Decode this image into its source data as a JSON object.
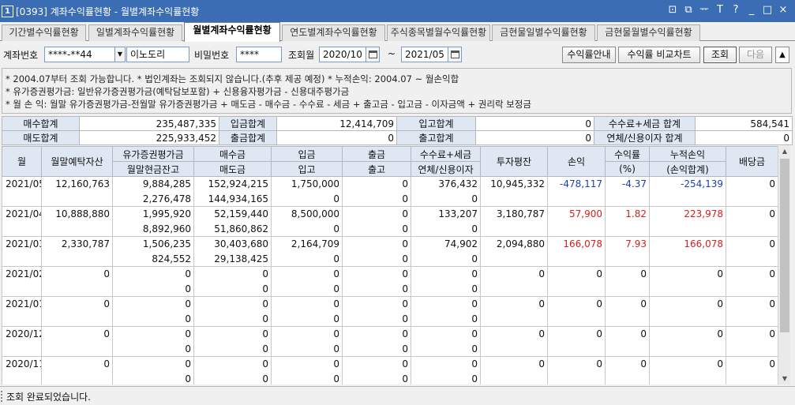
{
  "window": {
    "num": "1",
    "title": "[0393] 계좌수익률현황 - 월별계좌수익률현황",
    "controls": [
      "⊡",
      "⧉",
      "ᅲ",
      "T",
      "?",
      "_",
      "□",
      "×"
    ]
  },
  "tabs": [
    {
      "label": "기간별수익률현황",
      "active": false
    },
    {
      "label": "일별계좌수익률현황",
      "active": false
    },
    {
      "label": "월별계좌수익률현황",
      "active": true
    },
    {
      "label": "연도별계좌수익률현황",
      "active": false
    },
    {
      "label": "주식종목별월수익률현황",
      "active": false
    },
    {
      "label": "금현물일별수익률현황",
      "active": false
    },
    {
      "label": "금현물월별수익률현황",
      "active": false
    }
  ],
  "query": {
    "account_label": "계좌번호",
    "account_value": "****-**44",
    "account_name": "이노도리",
    "password_label": "비밀번호",
    "password_value": "****",
    "month_label": "조회월",
    "from_month": "2020/10",
    "tilde": "~",
    "to_month": "2021/05",
    "guide_button": "수익률안내",
    "compare_button": "수익률 비교차트",
    "search_button": "조회",
    "next_button": "다음",
    "up_arrow": "▲"
  },
  "notes": [
    "* 2004.07부터 조회 가능합니다.   * 법인계좌는 조회되지 않습니다.(추후 제공 예정)   * 누적손익: 2004.07 ~ 월손익합",
    "* 유가증권평가금: 일반유가증권평가금(예탁담보포함) + 신용융자평가금 - 신용대주평가금",
    "* 월 손 익: 월말 유가증권평가금-전월말 유가증권평가금 + 매도금 - 매수금 - 수수료 - 세금 + 출고금 - 입고금 - 이자금액 + 권리락 보정금"
  ],
  "summary": [
    [
      "매수합계",
      "235,487,335",
      "입금합계",
      "12,414,709",
      "입고합계",
      "0",
      "수수료+세금 합계",
      "584,541"
    ],
    [
      "매도합계",
      "225,933,452",
      "출금합계",
      "0",
      "출고합계",
      "0",
      "연체/신용이자 합계",
      "0"
    ]
  ],
  "grid": {
    "headers": {
      "month": "월",
      "deposit": "월말예탁자산",
      "sec_top": "유가증권평가금",
      "sec_bottom": "월말현금잔고",
      "buy_top": "매수금",
      "buy_bottom": "매도금",
      "in_top": "입금",
      "in_bottom": "입고",
      "out_top": "출금",
      "out_bottom": "출고",
      "fee_top": "수수료+세금",
      "fee_bottom": "연체/신용이자",
      "avg": "투자평잔",
      "pnl": "손익",
      "rate_top": "수익률",
      "rate_bottom": "(%)",
      "cum_top": "누적손익",
      "cum_bottom": "(손익합계)",
      "div": "배당금"
    },
    "rows": [
      {
        "month": "2021/05",
        "deposit": "12,160,763",
        "sec": "9,884,285",
        "cash": "2,276,478",
        "buy": "152,924,215",
        "sell": "144,934,165",
        "in": "1,750,000",
        "inn": "0",
        "out": "0",
        "outt": "0",
        "fee": "376,432",
        "interest": "0",
        "avg": "10,945,332",
        "pnl": "-478,117",
        "rate": "-4.37",
        "cum": "-254,139",
        "div": "0",
        "sign": "neg"
      },
      {
        "month": "2021/04",
        "deposit": "10,888,880",
        "sec": "1,995,920",
        "cash": "8,892,960",
        "buy": "52,159,440",
        "sell": "51,860,862",
        "in": "8,500,000",
        "inn": "0",
        "out": "0",
        "outt": "0",
        "fee": "133,207",
        "interest": "0",
        "avg": "3,180,787",
        "pnl": "57,900",
        "rate": "1.82",
        "cum": "223,978",
        "div": "0",
        "sign": "pos"
      },
      {
        "month": "2021/03",
        "deposit": "2,330,787",
        "sec": "1,506,235",
        "cash": "824,552",
        "buy": "30,403,680",
        "sell": "29,138,425",
        "in": "2,164,709",
        "inn": "0",
        "out": "0",
        "outt": "0",
        "fee": "74,902",
        "interest": "0",
        "avg": "2,094,880",
        "pnl": "166,078",
        "rate": "7.93",
        "cum": "166,078",
        "div": "0",
        "sign": "pos"
      },
      {
        "month": "2021/02",
        "deposit": "0",
        "sec": "0",
        "cash": "0",
        "buy": "0",
        "sell": "0",
        "in": "0",
        "inn": "0",
        "out": "0",
        "outt": "0",
        "fee": "0",
        "interest": "0",
        "avg": "0",
        "pnl": "0",
        "rate": "0",
        "cum": "0",
        "div": "0",
        "sign": "zero"
      },
      {
        "month": "2021/01",
        "deposit": "0",
        "sec": "0",
        "cash": "0",
        "buy": "0",
        "sell": "0",
        "in": "0",
        "inn": "0",
        "out": "0",
        "outt": "0",
        "fee": "0",
        "interest": "0",
        "avg": "0",
        "pnl": "0",
        "rate": "0",
        "cum": "0",
        "div": "0",
        "sign": "zero"
      },
      {
        "month": "2020/12",
        "deposit": "0",
        "sec": "0",
        "cash": "0",
        "buy": "0",
        "sell": "0",
        "in": "0",
        "inn": "0",
        "out": "0",
        "outt": "0",
        "fee": "0",
        "interest": "0",
        "avg": "0",
        "pnl": "0",
        "rate": "0",
        "cum": "0",
        "div": "0",
        "sign": "zero"
      },
      {
        "month": "2020/11",
        "deposit": "0",
        "sec": "0",
        "cash": "0",
        "buy": "0",
        "sell": "0",
        "in": "0",
        "inn": "0",
        "out": "0",
        "outt": "0",
        "fee": "0",
        "interest": "0",
        "avg": "0",
        "pnl": "0",
        "rate": "0",
        "cum": "0",
        "div": "0",
        "sign": "zero"
      }
    ]
  },
  "status": "조회 완료되었습니다.",
  "colors": {
    "title_bar": "#3b6db5",
    "header_bg": "#dfe7f2",
    "positive": "#d42020",
    "negative": "#1d3fae"
  }
}
